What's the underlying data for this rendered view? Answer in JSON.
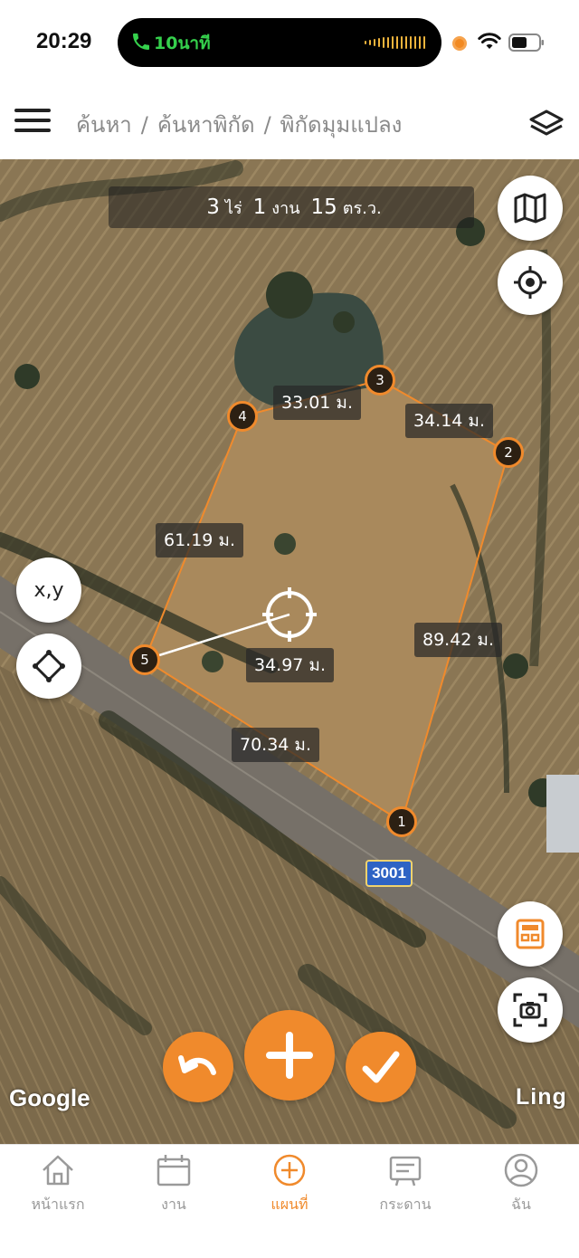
{
  "status_bar": {
    "time": "20:29",
    "call_duration": "10นาที",
    "recording_color": "#f28a22"
  },
  "header": {
    "menu_icon": "hamburger-menu-icon",
    "breadcrumb": [
      "ค้นหา",
      "ค้นหาพิกัด",
      "พิกัดมุมแปลง"
    ],
    "breadcrumb_separator": "/",
    "layers_icon": "layers-icon"
  },
  "map": {
    "area": {
      "rai_value": "3",
      "rai_unit": "ไร่",
      "ngan_value": "1",
      "ngan_unit": "งาน",
      "wa_value": "15",
      "wa_unit": "ตร.ว."
    },
    "plot_color": "#f08a2c",
    "markers": [
      "1",
      "2",
      "3",
      "4",
      "5"
    ],
    "distances": {
      "edge_4_3": "33.01 ม.",
      "edge_3_2": "34.14 ม.",
      "edge_5_4": "61.19 ม.",
      "edge_2_1": "89.42 ม.",
      "edge_1_5": "70.34 ม.",
      "crosshair_to_5": "34.97 ม."
    },
    "road_number": "3001",
    "xy_button": "x,y",
    "google_attribution": "Google",
    "watermark": "Ling",
    "side_buttons": [
      "map-type-icon",
      "my-location-icon",
      "calculator-icon",
      "screenshot-icon"
    ],
    "action_buttons": [
      "undo-icon",
      "plus-icon",
      "check-icon"
    ]
  },
  "bottom_nav": {
    "active": "แผนที่",
    "items": [
      {
        "label": "หน้าแรก",
        "icon": "home-icon"
      },
      {
        "label": "งาน",
        "icon": "calendar-icon"
      },
      {
        "label": "แผนที่",
        "icon": "add-circle-icon"
      },
      {
        "label": "กระดาน",
        "icon": "board-icon"
      },
      {
        "label": "ฉัน",
        "icon": "profile-icon"
      }
    ]
  }
}
